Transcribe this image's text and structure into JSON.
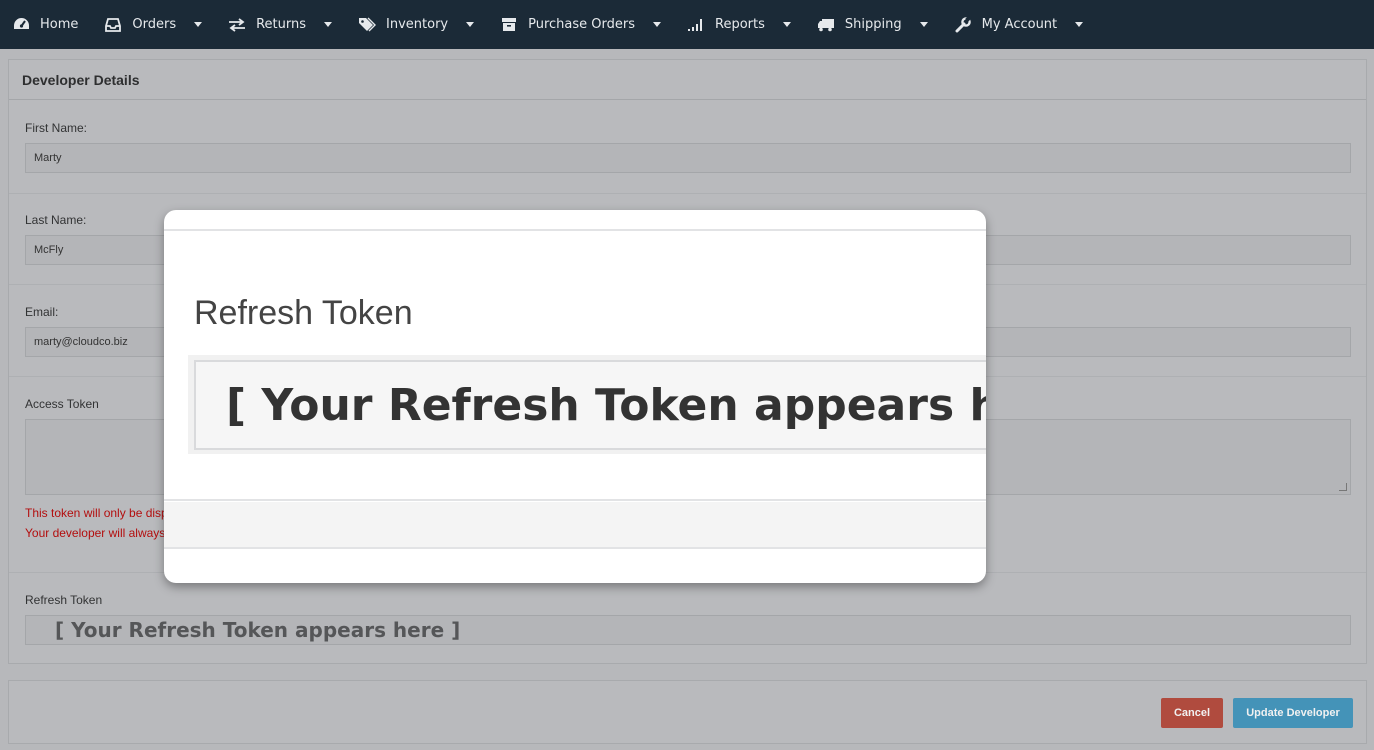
{
  "nav": {
    "items": [
      {
        "label": "Home",
        "icon": "dashboard-icon",
        "has_dropdown": false
      },
      {
        "label": "Orders",
        "icon": "inbox-icon",
        "has_dropdown": true
      },
      {
        "label": "Returns",
        "icon": "exchange-icon",
        "has_dropdown": true
      },
      {
        "label": "Inventory",
        "icon": "tags-icon",
        "has_dropdown": true
      },
      {
        "label": "Purchase Orders",
        "icon": "archive-icon",
        "has_dropdown": true
      },
      {
        "label": "Reports",
        "icon": "signal-icon",
        "has_dropdown": true
      },
      {
        "label": "Shipping",
        "icon": "truck-icon",
        "has_dropdown": true
      },
      {
        "label": "My Account",
        "icon": "wrench-icon",
        "has_dropdown": true
      }
    ]
  },
  "panel": {
    "title": "Developer Details",
    "first_name": {
      "label": "First Name:",
      "value": "Marty"
    },
    "last_name": {
      "label": "Last Name:",
      "value": "McFly"
    },
    "email": {
      "label": "Email:",
      "value": "marty@cloudco.biz"
    },
    "access_token": {
      "label": "Access Token",
      "value": ""
    },
    "warning_1": "This token will only be disp",
    "warning_2": "Your developer will always",
    "refresh_token": {
      "label": "Refresh Token",
      "value": "[ Your Refresh Token appears here ]"
    }
  },
  "footer": {
    "cancel_label": "Cancel",
    "update_label": "Update Developer"
  },
  "modal": {
    "title": "Refresh Token",
    "token_value": "[ Your Refresh Token appears here ]"
  },
  "colors": {
    "nav_bg": "#1b2a37",
    "cancel_button": "#b04b3e",
    "update_button": "#4493b8",
    "warning_text": "#b30e0e"
  }
}
